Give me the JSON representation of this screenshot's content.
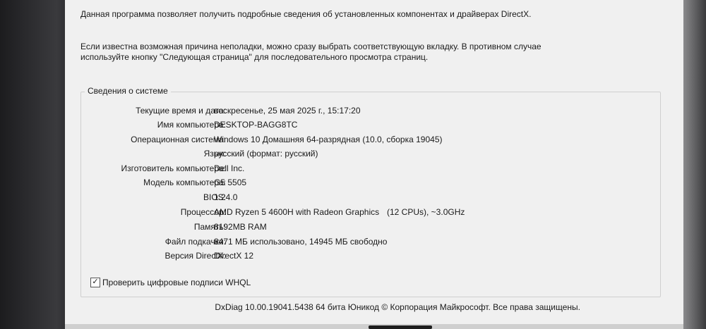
{
  "intro_text": "Данная программа позволяет получить подробные сведения об установленных компонентах и драйверах DirectX.",
  "help_text": "Если известна возможная причина неполадки, можно сразу выбрать соответствующую вкладку. В противном случае используйте кнопку \"Следующая страница\" для последовательного просмотра страниц.",
  "system_info": {
    "title": "Сведения о системе",
    "rows": [
      {
        "label": "Текущие время и дата:",
        "value": "воскресенье, 25 мая 2025 г., 15:17:20"
      },
      {
        "label": "Имя компьютера:",
        "value": "DESKTOP-BAGG8TC"
      },
      {
        "label": "Операционная система:",
        "value": "Windows 10 Домашняя 64-разрядная (10.0, сборка 19045)"
      },
      {
        "label": "Язык:",
        "value": "русский (формат: русский)"
      },
      {
        "label": "Изготовитель компьютера:",
        "value": "Dell Inc."
      },
      {
        "label": "Модель компьютера:",
        "value": "G5 5505"
      },
      {
        "label": "BIOS:",
        "value": "1.24.0"
      },
      {
        "label": "Процессор:",
        "value": "AMD Ryzen 5 4600H with Radeon Graphics",
        "value_extra": "(12 CPUs), ~3.0GHz"
      },
      {
        "label": "Память:",
        "value": "8192MB RAM"
      },
      {
        "label": "Файл подкачки:",
        "value": "8471 МБ использовано, 14945 МБ свободно"
      },
      {
        "label": "Версия DirectX:",
        "value": "DirectX 12"
      }
    ]
  },
  "whql_checkbox": {
    "label": "Проверить цифровые подписи WHQL",
    "checked": true,
    "check_glyph": "✓"
  },
  "footer": "DxDiag 10.00.19041.5438 64 бита Юникод © Корпорация Майкрософт. Все права защищены."
}
